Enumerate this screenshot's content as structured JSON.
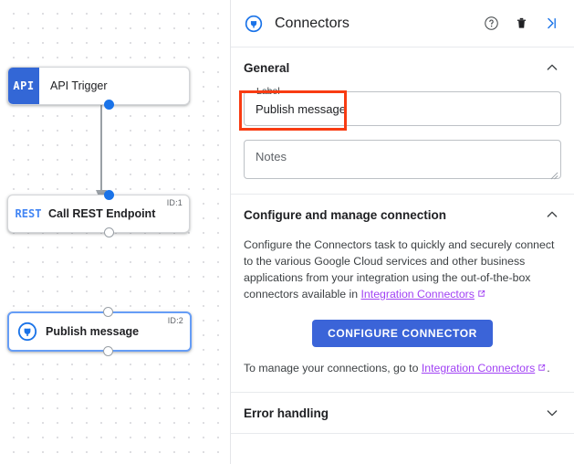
{
  "canvas": {
    "nodes": [
      {
        "name": "api-trigger",
        "label": "API Trigger",
        "badge_text": "API",
        "badge_kind": "api",
        "id_label": "",
        "selected": false
      },
      {
        "name": "call-rest-endpoint",
        "label": "Call REST Endpoint",
        "badge_text": "REST",
        "badge_kind": "rest",
        "id_label": "ID:1",
        "selected": false
      },
      {
        "name": "publish-message",
        "label": "Publish message",
        "badge_text": "connector-plug-icon",
        "badge_kind": "icon",
        "id_label": "ID:2",
        "selected": true
      }
    ]
  },
  "panel": {
    "header": {
      "icon": "connector-plug-icon",
      "title": "Connectors",
      "actions": [
        {
          "name": "help-icon",
          "glyph": "help"
        },
        {
          "name": "delete-icon",
          "glyph": "trash"
        },
        {
          "name": "collapse-panel-icon",
          "glyph": "collapse-right"
        }
      ]
    },
    "general": {
      "title": "General",
      "expanded": true,
      "label_field": {
        "label": "Label",
        "value": "Publish message"
      },
      "notes_field": {
        "placeholder": "Notes",
        "value": ""
      }
    },
    "configure": {
      "title": "Configure and manage connection",
      "expanded": true,
      "description_prefix": "Configure the Connectors task to quickly and securely connect to the various Google Cloud services and other business applications from your integration using the out-of-the-box connectors available in ",
      "description_link": "Integration Connectors",
      "description_suffix": "",
      "button_label": "CONFIGURE CONNECTOR",
      "manage_prefix": "To manage your connections, go to ",
      "manage_link": "Integration Connectors",
      "manage_suffix": "."
    },
    "error_handling": {
      "title": "Error handling",
      "expanded": false
    }
  },
  "colors": {
    "accent_blue": "#1a73e8",
    "button_blue": "#3b64d8",
    "badge_blue": "#3367d6",
    "link_purple": "#a142f4",
    "annotation_red": "#f83b12"
  }
}
